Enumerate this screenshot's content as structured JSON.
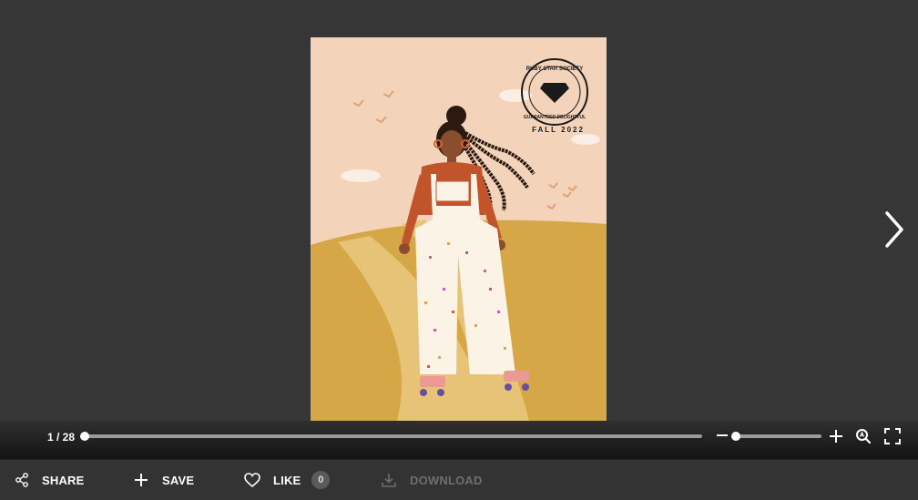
{
  "viewer": {
    "cover": {
      "badge_top_text": "RUBY STAR SOCIETY",
      "badge_bottom_text": "GUARANTEED DELIGHTFUL",
      "season": "FALL 2022"
    },
    "page_counter": "1 / 28",
    "current_page": 1,
    "total_pages": 28,
    "zoom_level": 0.02
  },
  "actions": {
    "share": "SHARE",
    "save": "SAVE",
    "like": "LIKE",
    "like_count": "0",
    "download": "DOWNLOAD"
  },
  "colors": {
    "background": "#363636",
    "action_bar": "#333333",
    "disabled_text": "#6e6e6e"
  }
}
